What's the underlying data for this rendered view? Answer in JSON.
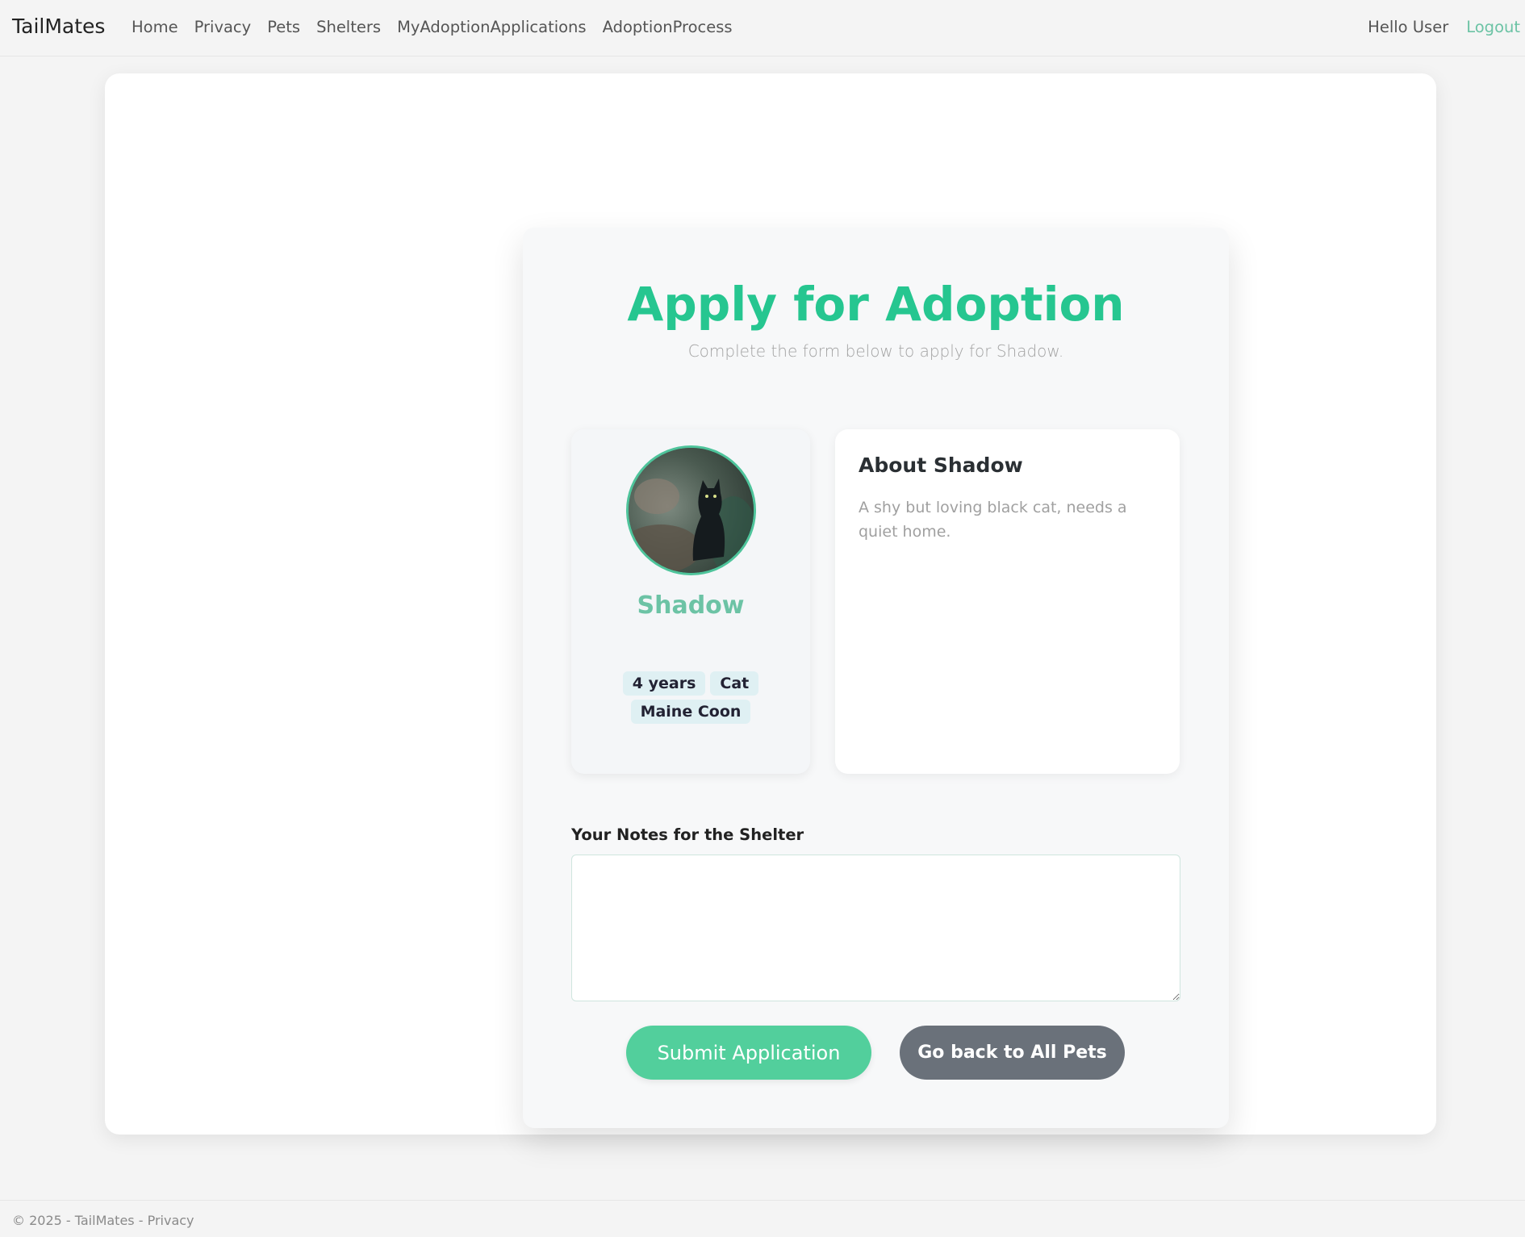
{
  "navbar": {
    "brand": "TailMates",
    "links": [
      "Home",
      "Privacy",
      "Pets",
      "Shelters",
      "MyAdoptionApplications",
      "AdoptionProcess"
    ],
    "greeting": "Hello User",
    "logout": "Logout"
  },
  "form": {
    "title": "Apply for Adoption",
    "subtitle": "Complete the form below to apply for Shadow.",
    "pet": {
      "name": "Shadow",
      "photo_icon": "cat-photo",
      "tags": [
        "4 years",
        "Cat",
        "Maine Coon"
      ]
    },
    "about": {
      "title": "About Shadow",
      "description": "A shy but loving black cat, needs a quiet home."
    },
    "notes": {
      "label": "Your Notes for the Shelter",
      "value": ""
    },
    "submit_label": "Submit Application",
    "back_label": "Go back to All Pets"
  },
  "footer": {
    "copyright": "© 2025 - TailMates - ",
    "privacy_link": "Privacy"
  },
  "colors": {
    "accent": "#26c690",
    "accent_soft": "#6cc3a5",
    "submit": "#52cf9c",
    "back": "#6a717a"
  }
}
